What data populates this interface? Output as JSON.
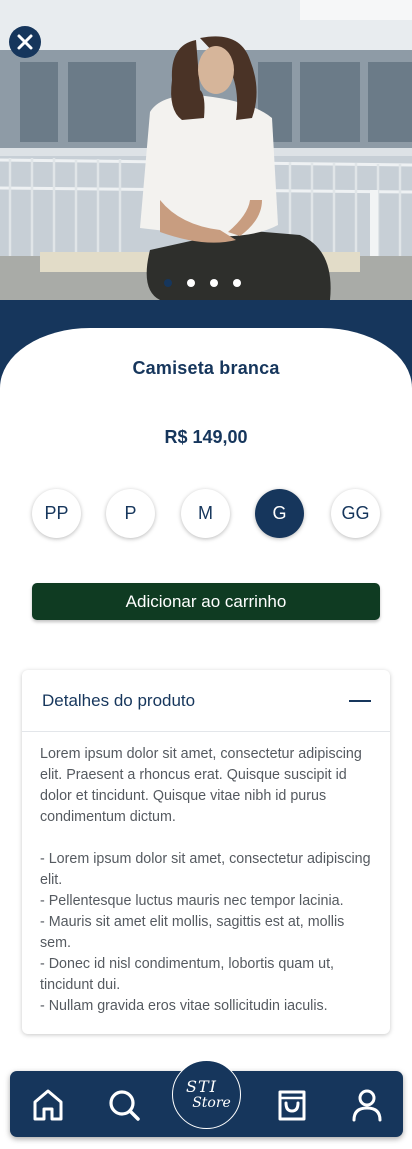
{
  "product": {
    "name": "Camiseta branca",
    "price": "R$ 149,00"
  },
  "gallery": {
    "dots": 4,
    "active_index": 0
  },
  "sizes": [
    "PP",
    "P",
    "M",
    "G",
    "GG"
  ],
  "selected_size": "G",
  "cart_button": {
    "label": "Adicionar ao carrinho"
  },
  "details": {
    "title": "Detalhes do produto",
    "paragraph": "Lorem ipsum dolor sit amet, consectetur adipiscing elit. Praesent a rhoncus erat. Quisque suscipit id dolor et tincidunt. Quisque vitae nibh id purus condimentum dictum.",
    "bullets": [
      "- Lorem ipsum dolor sit amet, consectetur adipiscing elit.",
      "- Pellentesque luctus mauris nec tempor lacinia.",
      "- Mauris sit amet elit mollis, sagittis est at, mollis sem.",
      "- Donec id nisl condimentum, lobortis quam ut, tincidunt dui.",
      "- Nullam gravida eros vitae sollicitudin iaculis."
    ]
  },
  "logo": {
    "line1": "STI",
    "line2": "Store"
  },
  "nav": {
    "items": [
      "home-icon",
      "search-icon",
      "logo",
      "bag-icon",
      "user-icon"
    ]
  },
  "colors": {
    "navy": "#16365c",
    "green": "#0f3b22",
    "white": "#ffffff"
  }
}
